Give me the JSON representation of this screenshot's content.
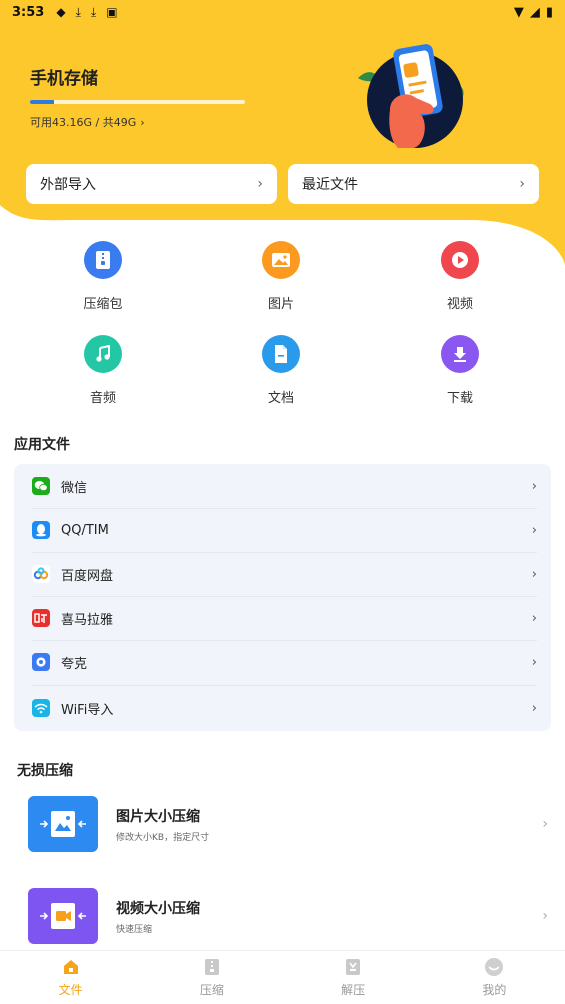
{
  "statusbar": {
    "time": "3:53"
  },
  "storage": {
    "title": "手机存储",
    "used_fraction": 0.11,
    "text": "可用43.16G / 共49G",
    "chevron": "›"
  },
  "quick_actions": [
    {
      "label": "外部导入",
      "chevron": "›"
    },
    {
      "label": "最近文件",
      "chevron": "›"
    }
  ],
  "categories": [
    {
      "label": "压缩包",
      "icon": "zip-icon",
      "color": "#3A7BEF"
    },
    {
      "label": "图片",
      "icon": "image-icon",
      "color": "#FB9A1E"
    },
    {
      "label": "视频",
      "icon": "play-icon",
      "color": "#F0474E"
    },
    {
      "label": "音频",
      "icon": "music-icon",
      "color": "#23C7A5"
    },
    {
      "label": "文档",
      "icon": "document-icon",
      "color": "#2A9BEB"
    },
    {
      "label": "下载",
      "icon": "download-icon",
      "color": "#8A58F0"
    }
  ],
  "app_section": {
    "title": "应用文件",
    "items": [
      {
        "label": "微信",
        "icon": "wechat-icon",
        "color": "#1AAD19",
        "chevron": "›"
      },
      {
        "label": "QQ/TIM",
        "icon": "qq-icon",
        "color": "#1E8CF5",
        "chevron": "›"
      },
      {
        "label": "百度网盘",
        "icon": "baidu-netdisk-icon",
        "color": "#2F7CF6",
        "chevron": "›"
      },
      {
        "label": "喜马拉雅",
        "icon": "ximalaya-icon",
        "color": "#E9302D",
        "chevron": "›"
      },
      {
        "label": "夸克",
        "icon": "quark-icon",
        "color": "#3A7BF5",
        "chevron": "›"
      },
      {
        "label": "WiFi导入",
        "icon": "wifi-icon",
        "color": "#18B5E8",
        "chevron": "›"
      }
    ]
  },
  "compress_section": {
    "title": "无损压缩",
    "items": [
      {
        "title": "图片大小压缩",
        "subtitle": "修改大小KB，指定尺寸",
        "icon": "image-compress-icon",
        "color": "#2C8AF0",
        "chevron": "›"
      },
      {
        "title": "视频大小压缩",
        "subtitle": "快速压缩",
        "icon": "video-compress-icon",
        "color": "#7E55F0",
        "chevron": "›"
      }
    ]
  },
  "bottom_nav": [
    {
      "label": "文件",
      "icon": "home-icon",
      "active": true
    },
    {
      "label": "压缩",
      "icon": "compress-icon",
      "active": false
    },
    {
      "label": "解压",
      "icon": "extract-icon",
      "active": false
    },
    {
      "label": "我的",
      "icon": "profile-icon",
      "active": false
    }
  ],
  "colors": {
    "accent": "#FDC82B",
    "nav_active": "#F4A519",
    "list_bg": "#F1F4FA"
  }
}
